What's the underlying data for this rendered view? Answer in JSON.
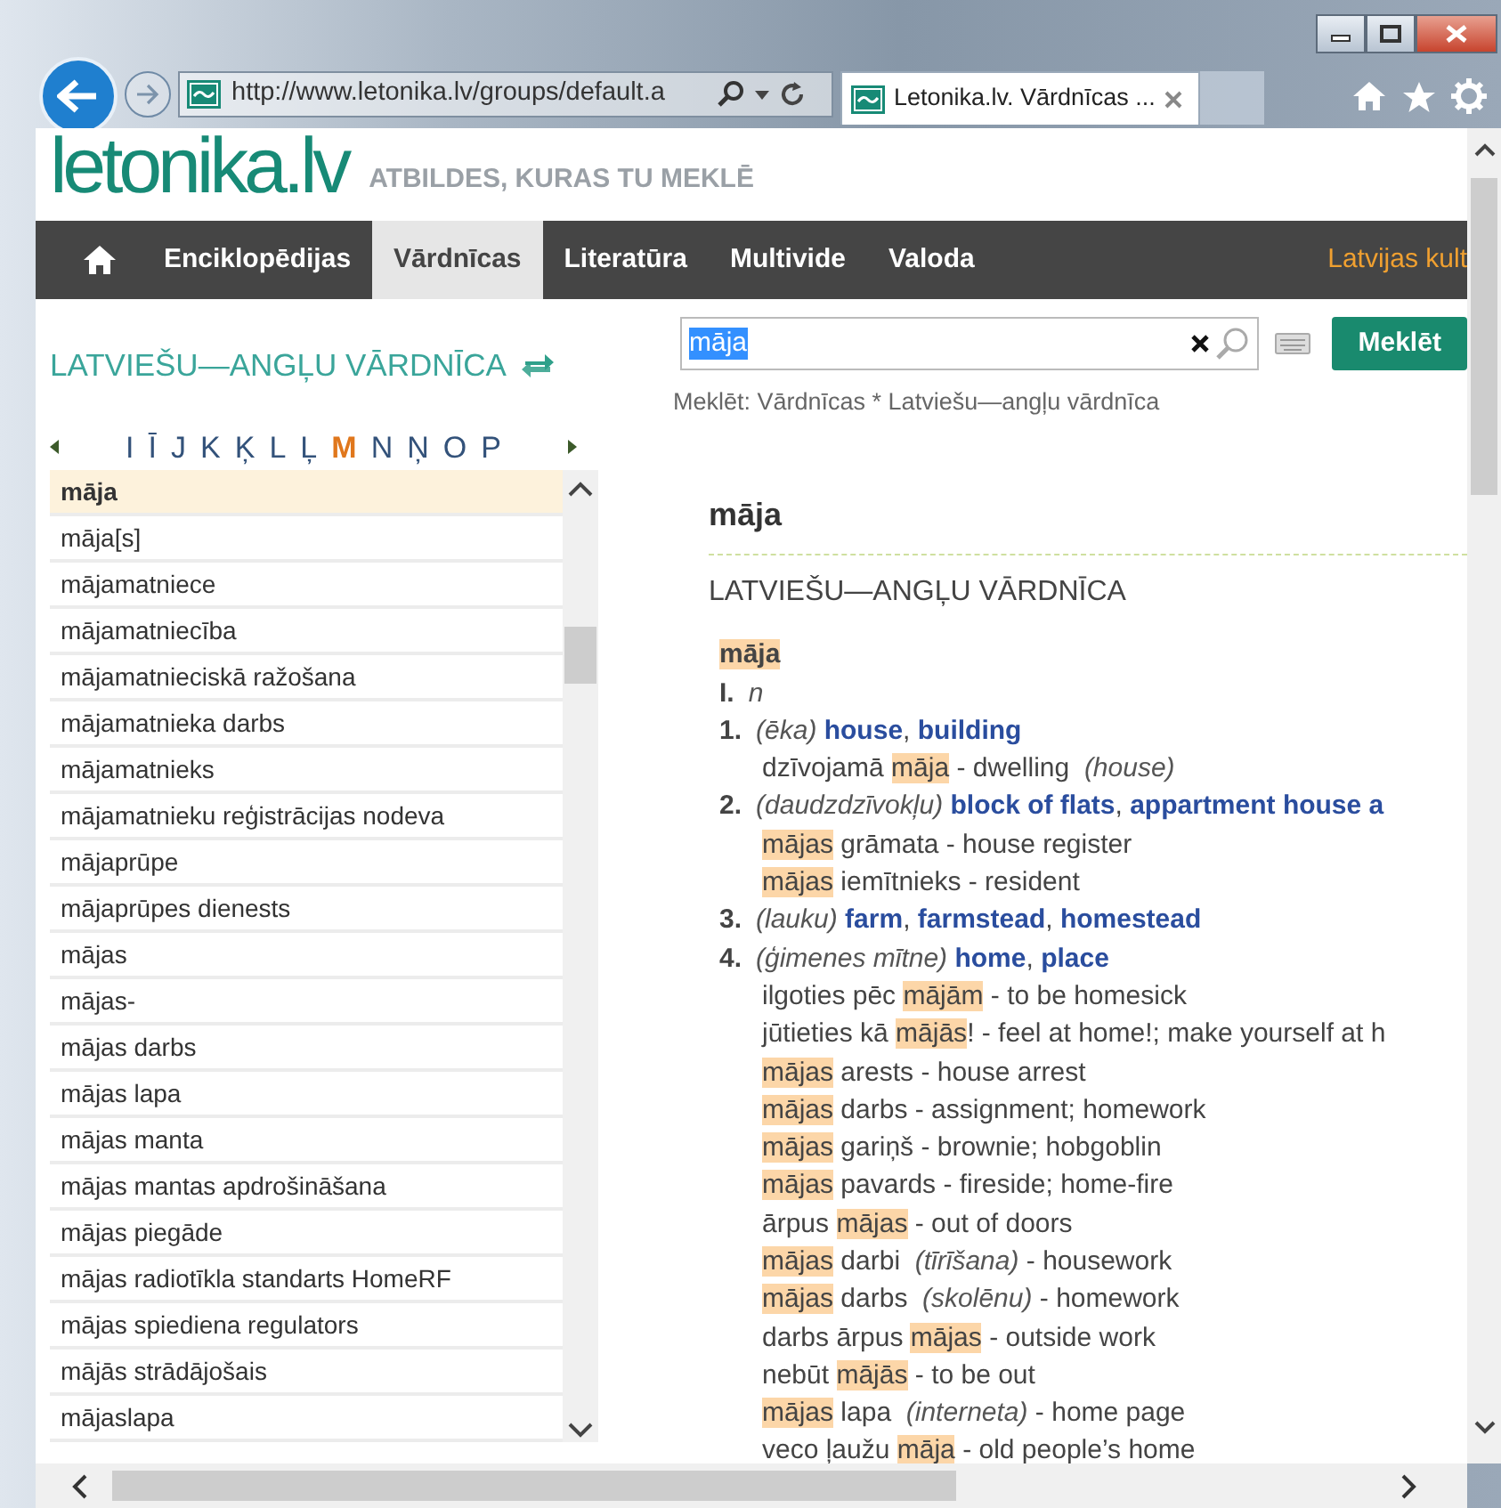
{
  "browser": {
    "address": "http://www.letonika.lv/groups/default.a",
    "tab_title": "Letonika.lv. Vārdnīcas ..."
  },
  "site": {
    "logo": "letonika.lv",
    "tagline": "ATBILDES, KURAS TU MEKLĒ"
  },
  "nav": [
    {
      "kind": "home",
      "selected": false
    },
    {
      "kind": "link",
      "label": "Enciklopēdijas",
      "selected": false
    },
    {
      "kind": "link",
      "label": "Vārdnīcas",
      "selected": true
    },
    {
      "kind": "link",
      "label": "Literatūra",
      "selected": false
    },
    {
      "kind": "link",
      "label": "Multivide",
      "selected": false
    },
    {
      "kind": "link",
      "label": "Valoda",
      "selected": false
    },
    {
      "kind": "promo",
      "label": "Latvijas kult",
      "selected": false
    }
  ],
  "dictionary_panel": {
    "title": "LATVIEŠU—ANGĻU VĀRDNĪCA",
    "letters": [
      {
        "label": "I",
        "selected": false
      },
      {
        "label": "Ī",
        "selected": false
      },
      {
        "label": "J",
        "selected": false
      },
      {
        "label": "K",
        "selected": false
      },
      {
        "label": "Ķ",
        "selected": false
      },
      {
        "label": "L",
        "selected": false
      },
      {
        "label": "Ļ",
        "selected": false
      },
      {
        "label": "M",
        "selected": true
      },
      {
        "label": "N",
        "selected": false
      },
      {
        "label": "Ņ",
        "selected": false
      },
      {
        "label": "O",
        "selected": false
      },
      {
        "label": "P",
        "selected": false
      }
    ],
    "words": [
      {
        "label": "māja",
        "selected": true
      },
      {
        "label": "māja[s]",
        "selected": false
      },
      {
        "label": "mājamatniece",
        "selected": false
      },
      {
        "label": "mājamatniecība",
        "selected": false
      },
      {
        "label": "mājamatnieciskā ražošana",
        "selected": false
      },
      {
        "label": "mājamatnieka darbs",
        "selected": false
      },
      {
        "label": "mājamatnieks",
        "selected": false
      },
      {
        "label": "mājamatnieku reģistrācijas nodeva",
        "selected": false
      },
      {
        "label": "mājaprūpe",
        "selected": false
      },
      {
        "label": "mājaprūpes dienests",
        "selected": false
      },
      {
        "label": "mājas",
        "selected": false
      },
      {
        "label": "mājas-",
        "selected": false
      },
      {
        "label": "mājas darbs",
        "selected": false
      },
      {
        "label": "mājas lapa",
        "selected": false
      },
      {
        "label": "mājas manta",
        "selected": false
      },
      {
        "label": "mājas mantas apdrošināšana",
        "selected": false
      },
      {
        "label": "mājas piegāde",
        "selected": false
      },
      {
        "label": "mājas radiotīkla standarts HomeRF",
        "selected": false
      },
      {
        "label": "mājas spiediena regulators",
        "selected": false
      },
      {
        "label": "mājās strādājošais",
        "selected": false
      },
      {
        "label": "mājaslapa",
        "selected": false
      }
    ]
  },
  "search": {
    "value": "māja",
    "button": "Meklēt",
    "scope": "Meklēt: Vārdnīcas * Latviešu—angļu vārdnīca"
  },
  "entry": {
    "title": "māja",
    "dictionary": "LATVIEŠU—ANGĻU VĀRDNĪCA",
    "headword": "māja",
    "lines": [
      {
        "number": "I.",
        "segments": [
          {
            "kind": "note",
            "text": "n"
          }
        ]
      },
      {
        "number": "1.",
        "segments": [
          {
            "kind": "note",
            "text": "(ēka) "
          },
          {
            "kind": "translation",
            "text": "house"
          },
          {
            "kind": "plain",
            "text": ", "
          },
          {
            "kind": "translation",
            "text": "building"
          }
        ]
      },
      {
        "segments": [
          {
            "kind": "plain",
            "text": "dzīvojamā "
          },
          {
            "kind": "match",
            "text": "māja"
          },
          {
            "kind": "plain",
            "text": " - dwelling  "
          },
          {
            "kind": "note",
            "text": "(house)"
          }
        ]
      },
      {
        "number": "2.",
        "segments": [
          {
            "kind": "note",
            "text": "(daudzdzīvokļu) "
          },
          {
            "kind": "translation",
            "text": "block of flats"
          },
          {
            "kind": "plain",
            "text": ", "
          },
          {
            "kind": "translation",
            "text": "appartment house a"
          }
        ]
      },
      {
        "segments": [
          {
            "kind": "match",
            "text": "mājas"
          },
          {
            "kind": "plain",
            "text": " grāmata - house register"
          }
        ]
      },
      {
        "segments": [
          {
            "kind": "match",
            "text": "mājas"
          },
          {
            "kind": "plain",
            "text": " iemītnieks - resident"
          }
        ]
      },
      {
        "number": "3.",
        "segments": [
          {
            "kind": "note",
            "text": "(lauku) "
          },
          {
            "kind": "translation",
            "text": "farm"
          },
          {
            "kind": "plain",
            "text": ", "
          },
          {
            "kind": "translation",
            "text": "farmstead"
          },
          {
            "kind": "plain",
            "text": ", "
          },
          {
            "kind": "translation",
            "text": "homestead"
          }
        ]
      },
      {
        "number": "4.",
        "segments": [
          {
            "kind": "note",
            "text": "(ģimenes mītne) "
          },
          {
            "kind": "translation",
            "text": "home"
          },
          {
            "kind": "plain",
            "text": ", "
          },
          {
            "kind": "translation",
            "text": "place"
          }
        ]
      },
      {
        "segments": [
          {
            "kind": "plain",
            "text": "ilgoties pēc "
          },
          {
            "kind": "match",
            "text": "mājām"
          },
          {
            "kind": "plain",
            "text": " - to be homesick"
          }
        ]
      },
      {
        "segments": [
          {
            "kind": "plain",
            "text": "jūtieties kā "
          },
          {
            "kind": "match",
            "text": "mājās"
          },
          {
            "kind": "plain",
            "text": "! - feel at home!; make yourself at h"
          }
        ]
      },
      {
        "segments": [
          {
            "kind": "match",
            "text": "mājas"
          },
          {
            "kind": "plain",
            "text": " arests - house arrest"
          }
        ]
      },
      {
        "segments": [
          {
            "kind": "match",
            "text": "mājas"
          },
          {
            "kind": "plain",
            "text": " darbs - assignment; homework"
          }
        ]
      },
      {
        "segments": [
          {
            "kind": "match",
            "text": "mājas"
          },
          {
            "kind": "plain",
            "text": " gariņš - brownie; hobgoblin"
          }
        ]
      },
      {
        "segments": [
          {
            "kind": "match",
            "text": "mājas"
          },
          {
            "kind": "plain",
            "text": " pavards - fireside; home-fire"
          }
        ]
      },
      {
        "segments": [
          {
            "kind": "plain",
            "text": "ārpus "
          },
          {
            "kind": "match",
            "text": "mājas"
          },
          {
            "kind": "plain",
            "text": " - out of doors"
          }
        ]
      },
      {
        "segments": [
          {
            "kind": "match",
            "text": "mājas"
          },
          {
            "kind": "plain",
            "text": " darbi  "
          },
          {
            "kind": "note",
            "text": "(tīrīšana)"
          },
          {
            "kind": "plain",
            "text": " - housework"
          }
        ]
      },
      {
        "segments": [
          {
            "kind": "match",
            "text": "mājas"
          },
          {
            "kind": "plain",
            "text": " darbs  "
          },
          {
            "kind": "note",
            "text": "(skolēnu)"
          },
          {
            "kind": "plain",
            "text": " - homework"
          }
        ]
      },
      {
        "segments": [
          {
            "kind": "plain",
            "text": "darbs ārpus "
          },
          {
            "kind": "match",
            "text": "mājas"
          },
          {
            "kind": "plain",
            "text": " - outside work"
          }
        ]
      },
      {
        "segments": [
          {
            "kind": "plain",
            "text": "nebūt "
          },
          {
            "kind": "match",
            "text": "mājās"
          },
          {
            "kind": "plain",
            "text": " - to be out"
          }
        ]
      },
      {
        "segments": [
          {
            "kind": "match",
            "text": "mājas"
          },
          {
            "kind": "plain",
            "text": " lapa  "
          },
          {
            "kind": "note",
            "text": "(interneta)"
          },
          {
            "kind": "plain",
            "text": " - home page"
          }
        ]
      },
      {
        "segments": [
          {
            "kind": "plain",
            "text": "veco ļaužu "
          },
          {
            "kind": "match",
            "text": "māja"
          },
          {
            "kind": "plain",
            "text": " - old people’s home"
          }
        ]
      }
    ]
  }
}
